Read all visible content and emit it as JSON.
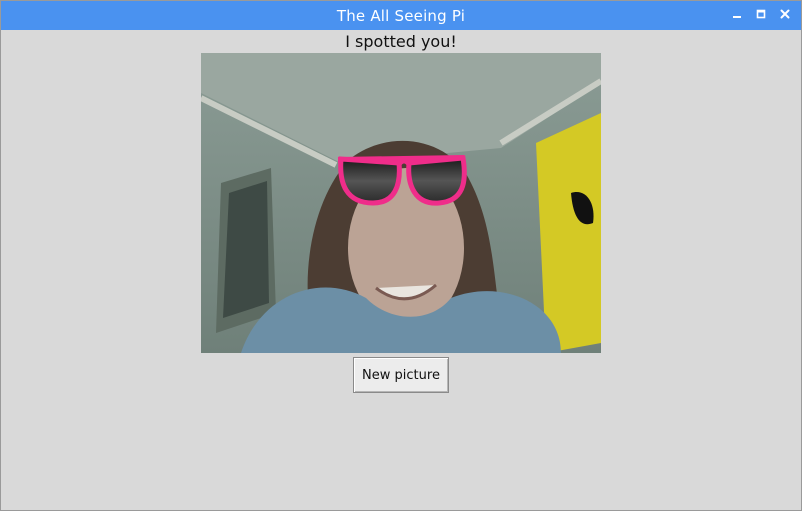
{
  "window": {
    "title": "The All Seeing Pi",
    "titlebar_color": "#4a92f0",
    "controls": [
      "minimize-icon",
      "maximize-icon",
      "close-icon"
    ]
  },
  "main": {
    "message": "I spotted you!",
    "photo": {
      "subject": "person wearing pink sunglasses overlay",
      "overlay_color": "#ef2d8a"
    },
    "new_picture_label": "New picture"
  }
}
